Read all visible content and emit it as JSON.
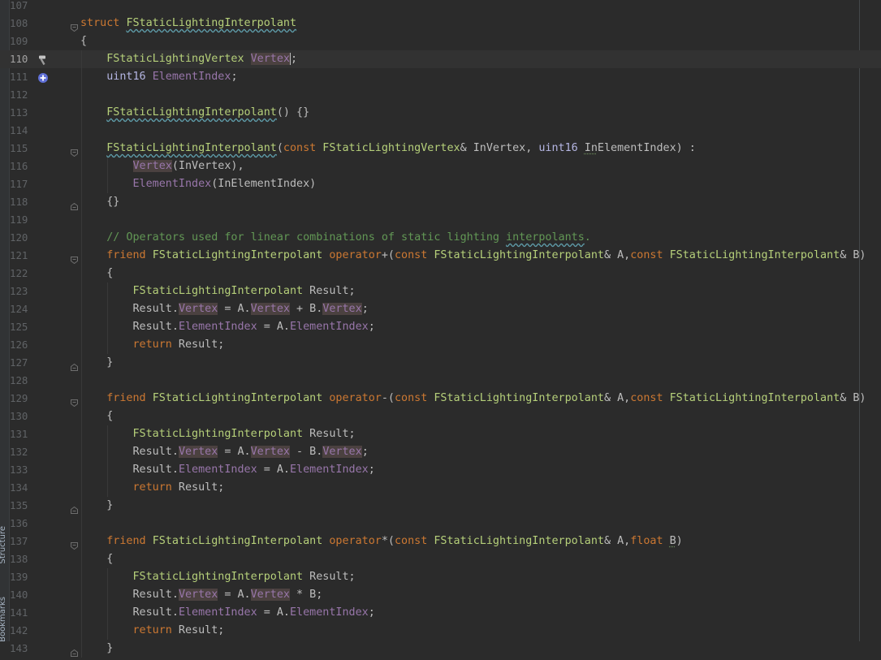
{
  "sidebar": {
    "tabs": [
      "Structure",
      "Bookmarks"
    ]
  },
  "editor": {
    "lines": [
      {
        "n": "107",
        "text": ""
      },
      {
        "n": "108",
        "text": "struct FStaticLightingInterpolant"
      },
      {
        "n": "109",
        "text": "{"
      },
      {
        "n": "110",
        "text": "    FStaticLightingVertex Vertex;"
      },
      {
        "n": "111",
        "text": "    uint16 ElementIndex;"
      },
      {
        "n": "112",
        "text": ""
      },
      {
        "n": "113",
        "text": "    FStaticLightingInterpolant() {}"
      },
      {
        "n": "114",
        "text": ""
      },
      {
        "n": "115",
        "text": "    FStaticLightingInterpolant(const FStaticLightingVertex& InVertex, uint16 InElementIndex) :"
      },
      {
        "n": "116",
        "text": "        Vertex(InVertex),"
      },
      {
        "n": "117",
        "text": "        ElementIndex(InElementIndex)"
      },
      {
        "n": "118",
        "text": "    {}"
      },
      {
        "n": "119",
        "text": ""
      },
      {
        "n": "120",
        "text": "    // Operators used for linear combinations of static lighting interpolants."
      },
      {
        "n": "121",
        "text": "    friend FStaticLightingInterpolant operator+(const FStaticLightingInterpolant& A,const FStaticLightingInterpolant& B)"
      },
      {
        "n": "122",
        "text": "    {"
      },
      {
        "n": "123",
        "text": "        FStaticLightingInterpolant Result;"
      },
      {
        "n": "124",
        "text": "        Result.Vertex = A.Vertex + B.Vertex;"
      },
      {
        "n": "125",
        "text": "        Result.ElementIndex = A.ElementIndex;"
      },
      {
        "n": "126",
        "text": "        return Result;"
      },
      {
        "n": "127",
        "text": "    }"
      },
      {
        "n": "128",
        "text": ""
      },
      {
        "n": "129",
        "text": "    friend FStaticLightingInterpolant operator-(const FStaticLightingInterpolant& A,const FStaticLightingInterpolant& B)"
      },
      {
        "n": "130",
        "text": "    {"
      },
      {
        "n": "131",
        "text": "        FStaticLightingInterpolant Result;"
      },
      {
        "n": "132",
        "text": "        Result.Vertex = A.Vertex - B.Vertex;"
      },
      {
        "n": "133",
        "text": "        Result.ElementIndex = A.ElementIndex;"
      },
      {
        "n": "134",
        "text": "        return Result;"
      },
      {
        "n": "135",
        "text": "    }"
      },
      {
        "n": "136",
        "text": ""
      },
      {
        "n": "137",
        "text": "    friend FStaticLightingInterpolant operator*(const FStaticLightingInterpolant& A,float B)"
      },
      {
        "n": "138",
        "text": "    {"
      },
      {
        "n": "139",
        "text": "        FStaticLightingInterpolant Result;"
      },
      {
        "n": "140",
        "text": "        Result.Vertex = A.Vertex * B;"
      },
      {
        "n": "141",
        "text": "        Result.ElementIndex = A.ElementIndex;"
      },
      {
        "n": "142",
        "text": "        return Result;"
      },
      {
        "n": "143",
        "text": "    }"
      }
    ],
    "current_line": "110",
    "gutter_icons": [
      {
        "line": "110",
        "icon": "hammer-icon"
      },
      {
        "line": "111",
        "icon": "implements-icon"
      }
    ],
    "fold_markers": [
      {
        "line": "108",
        "kind": "open"
      },
      {
        "line": "115",
        "kind": "open"
      },
      {
        "line": "118",
        "kind": "close"
      },
      {
        "line": "121",
        "kind": "open"
      },
      {
        "line": "127",
        "kind": "close"
      },
      {
        "line": "129",
        "kind": "open"
      },
      {
        "line": "135",
        "kind": "close"
      },
      {
        "line": "137",
        "kind": "open"
      },
      {
        "line": "143",
        "kind": "close"
      }
    ],
    "keywords": [
      "struct",
      "const",
      "friend",
      "return",
      "float",
      "operator"
    ],
    "types": [
      "uint16"
    ],
    "classes": [
      "FStaticLightingInterpolant",
      "FStaticLightingVertex"
    ],
    "fields": [
      "Vertex",
      "ElementIndex"
    ],
    "colors": {
      "background": "#2b2b2b",
      "keyword": "#cc7832",
      "class": "#b6d07a",
      "field": "#9876aa",
      "comment": "#629755",
      "line_number": "#606366"
    }
  }
}
